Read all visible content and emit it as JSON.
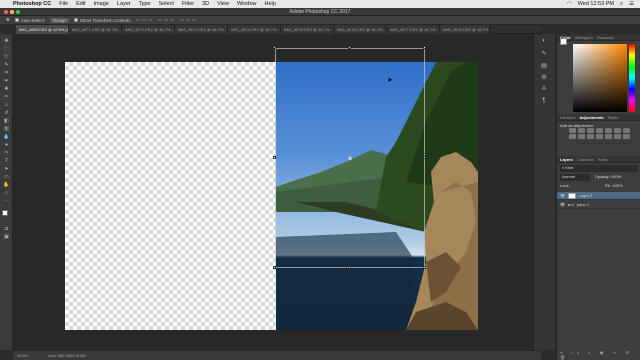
{
  "mac_menu": {
    "app": "Photoshop CC",
    "items": [
      "File",
      "Edit",
      "Image",
      "Layer",
      "Type",
      "Select",
      "Filter",
      "3D",
      "View",
      "Window",
      "Help"
    ],
    "clock": "Wed 12:53 PM"
  },
  "window": {
    "title": "Adobe Photoshop CC 2017"
  },
  "options_bar": {
    "auto_select": "Auto-Select:",
    "auto_select_value": "Group",
    "transform_controls": "Show Transform Controls"
  },
  "tabs": [
    {
      "label": "IMG_4063.CR2 @ 12.5% (Layer 2, RGB/16*) ×",
      "active": true
    },
    {
      "label": "IMG_4071.CR2 @ 16.7%...",
      "active": false
    },
    {
      "label": "IMG_4072.CR2 @ 16.7%...",
      "active": false
    },
    {
      "label": "IMG_4073.CR2 @ 16.7%...",
      "active": false
    },
    {
      "label": "IMG_4074.CR2 @ 16.7%...",
      "active": false
    },
    {
      "label": "IMG_4075.CR2 @ 16.7%...",
      "active": false
    },
    {
      "label": "IMG_4076.CR2 @ 16.7%...",
      "active": false
    },
    {
      "label": "IMG_4077.CR2 @ 16.7%...",
      "active": false
    },
    {
      "label": "IMG_4078.CR2 @ 16.7%...",
      "active": false
    }
  ],
  "status": {
    "zoom": "12.5%",
    "doc": "Doc: 360.0M/475.2M"
  },
  "panels": {
    "color_tabs": [
      "Color",
      "Histogram",
      "Swatches"
    ],
    "lib_tabs": [
      "Libraries",
      "Adjustments",
      "Styles"
    ],
    "add_adjustment": "Add an adjustment",
    "layers_tabs": [
      "Layers",
      "Channels",
      "Paths"
    ],
    "kind": "Kind",
    "blend": "Normal",
    "opacity_label": "Opacity:",
    "opacity": "100%",
    "lock_label": "Lock:",
    "fill_label": "Fill:",
    "fill": "100%",
    "layers": [
      {
        "name": "Layer 2",
        "selected": true
      },
      {
        "name": "pano 1",
        "selected": false
      }
    ]
  },
  "colors": {
    "fg": "#ffffff",
    "bg": "#000000"
  }
}
